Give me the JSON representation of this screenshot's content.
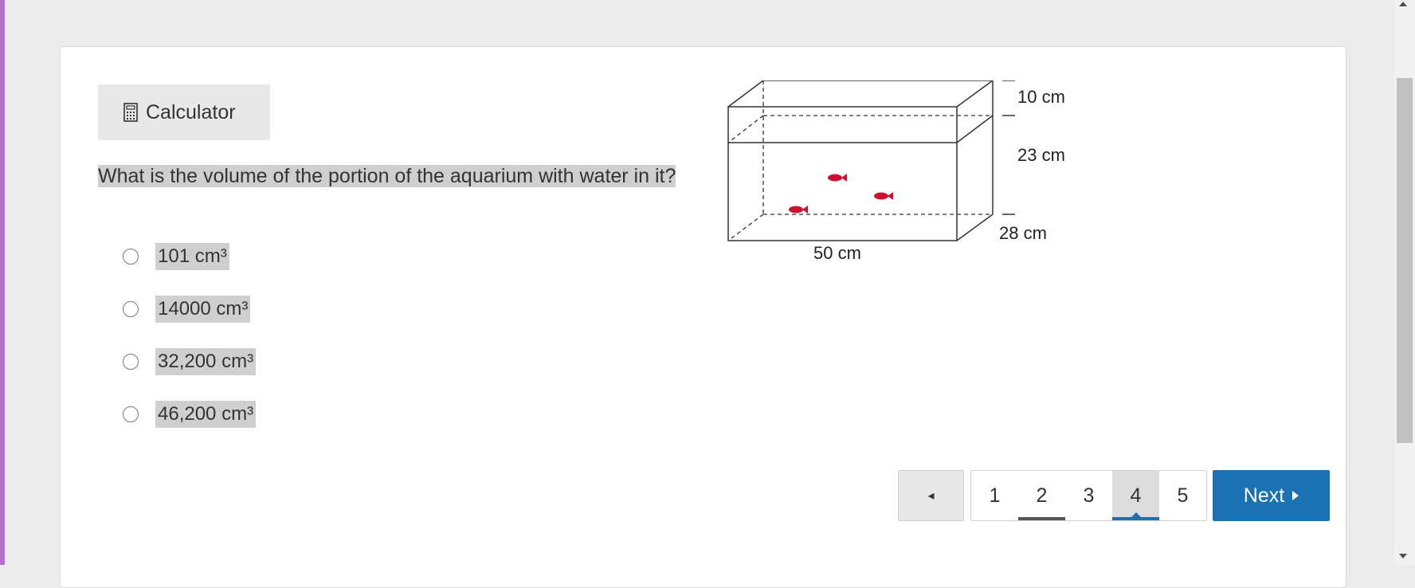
{
  "toolbar": {
    "calculator_label": "Calculator"
  },
  "question": {
    "text": "What is the volume of the portion of the aquarium with water in it?"
  },
  "options": [
    {
      "label": "101 cm³"
    },
    {
      "label": "14000 cm³"
    },
    {
      "label": "32,200 cm³"
    },
    {
      "label": "46,200 cm³"
    }
  ],
  "figure": {
    "top_gap_label": "10 cm",
    "water_height_label": "23 cm",
    "depth_label": "28 cm",
    "length_label": "50 cm",
    "fish_color": "#d0102e"
  },
  "pagination": {
    "prev_symbol": "◂",
    "pages": [
      "1",
      "2",
      "3",
      "4",
      "5"
    ],
    "current_page": "4",
    "next_label": "Next"
  },
  "colors": {
    "accent_left": "#b46ed0",
    "next_button": "#1a72b4",
    "highlight": "#cfcfcf"
  }
}
